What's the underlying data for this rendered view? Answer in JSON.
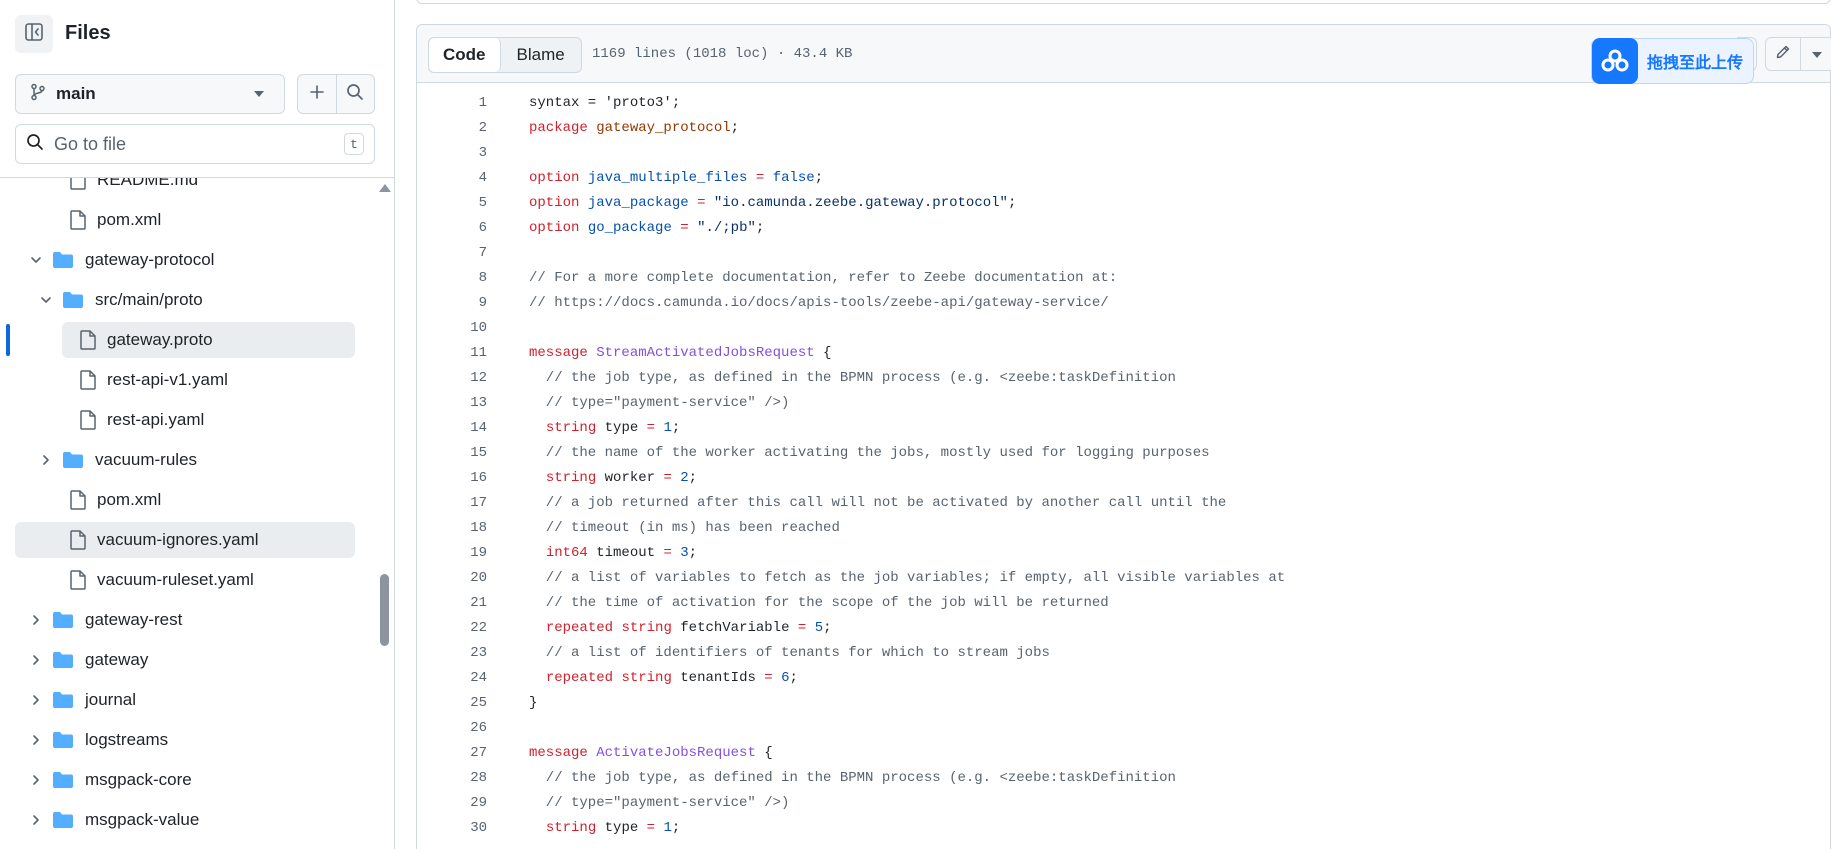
{
  "sidebar": {
    "title": "Files",
    "branch": "main",
    "search_placeholder": "Go to file",
    "search_shortcut": "t",
    "tree": [
      {
        "label": "README.md",
        "type": "file",
        "depth": 1
      },
      {
        "label": "pom.xml",
        "type": "file",
        "depth": 1
      },
      {
        "label": "gateway-protocol",
        "type": "folder",
        "expanded": true,
        "depth": 0
      },
      {
        "label": "src/main/proto",
        "type": "folder",
        "expanded": true,
        "depth": 1
      },
      {
        "label": "gateway.proto",
        "type": "file",
        "depth": 2,
        "active": true
      },
      {
        "label": "rest-api-v1.yaml",
        "type": "file",
        "depth": 2
      },
      {
        "label": "rest-api.yaml",
        "type": "file",
        "depth": 2
      },
      {
        "label": "vacuum-rules",
        "type": "folder",
        "expanded": false,
        "depth": 1
      },
      {
        "label": "pom.xml",
        "type": "file",
        "depth": 1
      },
      {
        "label": "vacuum-ignores.yaml",
        "type": "file",
        "depth": 1,
        "hover": true
      },
      {
        "label": "vacuum-ruleset.yaml",
        "type": "file",
        "depth": 1
      },
      {
        "label": "gateway-rest",
        "type": "folder",
        "expanded": false,
        "depth": 0
      },
      {
        "label": "gateway",
        "type": "folder",
        "expanded": false,
        "depth": 0
      },
      {
        "label": "journal",
        "type": "folder",
        "expanded": false,
        "depth": 0
      },
      {
        "label": "logstreams",
        "type": "folder",
        "expanded": false,
        "depth": 0
      },
      {
        "label": "msgpack-core",
        "type": "folder",
        "expanded": false,
        "depth": 0
      },
      {
        "label": "msgpack-value",
        "type": "folder",
        "expanded": false,
        "depth": 0
      }
    ]
  },
  "file_header": {
    "code_tab": "Code",
    "blame_tab": "Blame",
    "info": "1169 lines (1018 loc) · 43.4 KB",
    "upload_label": "拖拽至此上传"
  },
  "colors": {
    "keyword": "#cf222e",
    "string": "#0a3069",
    "number": "#0550ae",
    "comment": "#59636e",
    "type_name": "#8250df",
    "field": "#953800",
    "folder": "#54aeff",
    "accent": "#0969da"
  },
  "code": [
    [
      [
        "syntax = 'proto3';",
        ""
      ]
    ],
    [
      [
        "package",
        "k"
      ],
      [
        " ",
        ""
      ],
      [
        "gateway_protocol",
        "f"
      ],
      [
        ";",
        ""
      ]
    ],
    [],
    [
      [
        "option",
        "k"
      ],
      [
        " ",
        ""
      ],
      [
        "java_multiple_files",
        "n"
      ],
      [
        " ",
        ""
      ],
      [
        "=",
        "k"
      ],
      [
        " ",
        ""
      ],
      [
        "false",
        "n"
      ],
      [
        ";",
        ""
      ]
    ],
    [
      [
        "option",
        "k"
      ],
      [
        " ",
        ""
      ],
      [
        "java_package",
        "n"
      ],
      [
        " ",
        ""
      ],
      [
        "=",
        "k"
      ],
      [
        " ",
        ""
      ],
      [
        "\"io.camunda.zeebe.gateway.protocol\"",
        "s"
      ],
      [
        ";",
        ""
      ]
    ],
    [
      [
        "option",
        "k"
      ],
      [
        " ",
        ""
      ],
      [
        "go_package",
        "n"
      ],
      [
        " ",
        ""
      ],
      [
        "=",
        "k"
      ],
      [
        " ",
        ""
      ],
      [
        "\"./;pb\"",
        "s"
      ],
      [
        ";",
        ""
      ]
    ],
    [],
    [
      [
        "// For a more complete documentation, refer to Zeebe documentation at:",
        "c"
      ]
    ],
    [
      [
        "// https://docs.camunda.io/docs/apis-tools/zeebe-api/gateway-service/",
        "c"
      ]
    ],
    [],
    [
      [
        "message",
        "k"
      ],
      [
        " ",
        ""
      ],
      [
        "StreamActivatedJobsRequest",
        "t"
      ],
      [
        " {",
        ""
      ]
    ],
    [
      [
        "  // the job type, as defined in the BPMN process (e.g. <zeebe:taskDefinition",
        "c"
      ]
    ],
    [
      [
        "  // type=\"payment-service\" />)",
        "c"
      ]
    ],
    [
      [
        "  ",
        ""
      ],
      [
        "string",
        "k"
      ],
      [
        " type ",
        ""
      ],
      [
        "=",
        "k"
      ],
      [
        " ",
        ""
      ],
      [
        "1",
        "n"
      ],
      [
        ";",
        ""
      ]
    ],
    [
      [
        "  // the name of the worker activating the jobs, mostly used for logging purposes",
        "c"
      ]
    ],
    [
      [
        "  ",
        ""
      ],
      [
        "string",
        "k"
      ],
      [
        " worker ",
        ""
      ],
      [
        "=",
        "k"
      ],
      [
        " ",
        ""
      ],
      [
        "2",
        "n"
      ],
      [
        ";",
        ""
      ]
    ],
    [
      [
        "  // a job returned after this call will not be activated by another call until the",
        "c"
      ]
    ],
    [
      [
        "  // timeout (in ms) has been reached",
        "c"
      ]
    ],
    [
      [
        "  ",
        ""
      ],
      [
        "int64",
        "k"
      ],
      [
        " timeout ",
        ""
      ],
      [
        "=",
        "k"
      ],
      [
        " ",
        ""
      ],
      [
        "3",
        "n"
      ],
      [
        ";",
        ""
      ]
    ],
    [
      [
        "  // a list of variables to fetch as the job variables; if empty, all visible variables at",
        "c"
      ]
    ],
    [
      [
        "  // the time of activation for the scope of the job will be returned",
        "c"
      ]
    ],
    [
      [
        "  ",
        ""
      ],
      [
        "repeated",
        "k"
      ],
      [
        " ",
        ""
      ],
      [
        "string",
        "k"
      ],
      [
        " fetchVariable ",
        ""
      ],
      [
        "=",
        "k"
      ],
      [
        " ",
        ""
      ],
      [
        "5",
        "n"
      ],
      [
        ";",
        ""
      ]
    ],
    [
      [
        "  // a list of identifiers of tenants for which to stream jobs",
        "c"
      ]
    ],
    [
      [
        "  ",
        ""
      ],
      [
        "repeated",
        "k"
      ],
      [
        " ",
        ""
      ],
      [
        "string",
        "k"
      ],
      [
        " tenantIds ",
        ""
      ],
      [
        "=",
        "k"
      ],
      [
        " ",
        ""
      ],
      [
        "6",
        "n"
      ],
      [
        ";",
        ""
      ]
    ],
    [
      [
        "}",
        ""
      ]
    ],
    [],
    [
      [
        "message",
        "k"
      ],
      [
        " ",
        ""
      ],
      [
        "ActivateJobsRequest",
        "t"
      ],
      [
        " {",
        ""
      ]
    ],
    [
      [
        "  // the job type, as defined in the BPMN process (e.g. <zeebe:taskDefinition",
        "c"
      ]
    ],
    [
      [
        "  // type=\"payment-service\" />)",
        "c"
      ]
    ],
    [
      [
        "  ",
        ""
      ],
      [
        "string",
        "k"
      ],
      [
        " type ",
        ""
      ],
      [
        "=",
        "k"
      ],
      [
        " ",
        ""
      ],
      [
        "1",
        "n"
      ],
      [
        ";",
        ""
      ]
    ]
  ]
}
